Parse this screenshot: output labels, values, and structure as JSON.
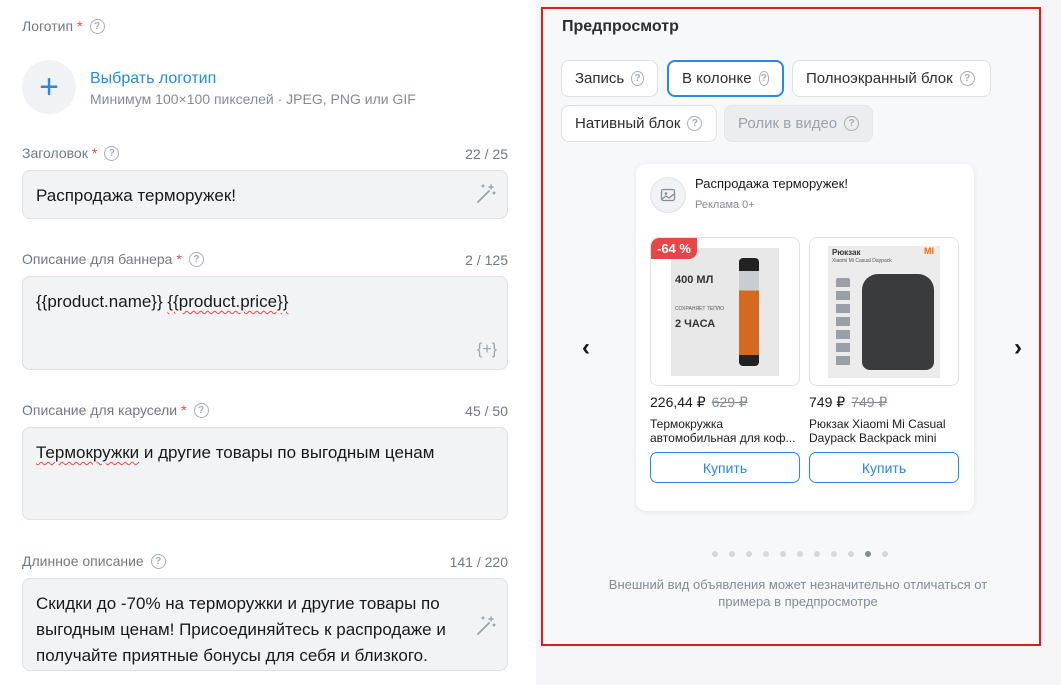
{
  "form": {
    "logo": {
      "label": "Логотип",
      "required_mark": "*",
      "help": "?",
      "add_icon": "plus-icon",
      "link": "Выбрать логотип",
      "hint": "Минимум 100×100 пикселей · JPEG, PNG или GIF"
    },
    "headline": {
      "label": "Заголовок",
      "required_mark": "*",
      "help": "?",
      "counter": "22 / 25",
      "value": "Распродажа терморужек!",
      "icon": "magic-wand-icon"
    },
    "banner_description": {
      "label": "Описание для баннера",
      "required_mark": "*",
      "help": "?",
      "counter": "2 / 125",
      "value_part1": "{{product.name}}",
      "value_part2": "{{product.price}}",
      "icon": "insert-variable-icon",
      "icon_text": "{+}"
    },
    "carousel_description": {
      "label": "Описание для карусели",
      "required_mark": "*",
      "help": "?",
      "counter": "45 / 50",
      "value_word1": "Термокружки",
      "value_rest": " и другие товары по выгодным ценам"
    },
    "long_description": {
      "label": "Длинное описание",
      "help": "?",
      "counter": "141 / 220",
      "value": "Скидки до -70% на терморужки и другие товары по выгодным ценам! Присоединяйтесь к распродаже и получайте приятные бонусы для себя и близкого.",
      "icon": "magic-wand-icon"
    }
  },
  "preview": {
    "title": "Предпросмотр",
    "formats": [
      {
        "label": "Запись",
        "state": "normal"
      },
      {
        "label": "В колонке",
        "state": "active"
      },
      {
        "label": "Полноэкранный блок",
        "state": "normal"
      },
      {
        "label": "Нативный блок",
        "state": "normal"
      },
      {
        "label": "Ролик в видео",
        "state": "disabled"
      }
    ],
    "help": "?",
    "ad": {
      "title": "Распродажа терморужек!",
      "subtitle": "Реклама 0+",
      "avatar_icon": "image-icon",
      "products": [
        {
          "discount": "-64 %",
          "price": "226,44 ₽",
          "old_price": "629 ₽",
          "name_line1": "Термокружка",
          "name_line2": "автомобильная для коф...",
          "buy": "Купить",
          "img_text1": "400 МЛ",
          "img_text2": "СОХРАНЯЕТ ТЕПЛО",
          "img_text3": "2 ЧАСА"
        },
        {
          "discount": "",
          "price": "749 ₽",
          "old_price": "749 ₽",
          "name_line1": "Рюкзак Xiaomi Mi Casual",
          "name_line2": "Daypack Backpack mini",
          "buy": "Купить",
          "img_text1": "Рюкзак",
          "img_text2": "Xiaomi Mi Casual Daypack",
          "img_text3": "MI"
        }
      ]
    },
    "prev_icon": "‹",
    "next_icon": "›",
    "dots_total": 11,
    "dots_active_index": 9,
    "disclaimer": "Внешний вид объявления может незначительно отличаться от примера в предпросмотре",
    "colors": {
      "accent": "#2688eb",
      "highlight_border": "#e21b1b",
      "discount": "#e64646"
    }
  }
}
